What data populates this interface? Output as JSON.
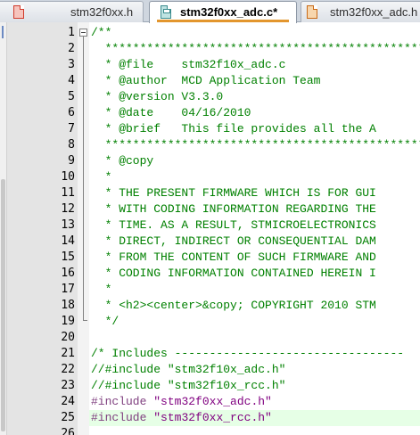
{
  "tabs": [
    {
      "label": "stm32f0xx.h",
      "icon": "file-icon",
      "active": false
    },
    {
      "label": "stm32f0xx_adc.c*",
      "icon": "save-file-icon",
      "active": true
    },
    {
      "label": "stm32f0xx_adc.h",
      "icon": "file-icon",
      "active": false
    }
  ],
  "colors": {
    "comment": "#008000",
    "preprocessor": "#804080",
    "string": "#800080",
    "current_line_bg": "#e6ffe6",
    "gutter_bg": "#e4e4e4"
  },
  "editor": {
    "current_line": 25,
    "lines": [
      {
        "n": "1",
        "kind": "comment",
        "text": "/**"
      },
      {
        "n": "2",
        "kind": "comment",
        "text": "  ******************************************************************"
      },
      {
        "n": "3",
        "kind": "comment",
        "text": "  * @file    stm32f10x_adc.c"
      },
      {
        "n": "4",
        "kind": "comment",
        "text": "  * @author  MCD Application Team"
      },
      {
        "n": "5",
        "kind": "comment",
        "text": "  * @version V3.3.0"
      },
      {
        "n": "6",
        "kind": "comment",
        "text": "  * @date    04/16/2010"
      },
      {
        "n": "7",
        "kind": "comment",
        "text": "  * @brief   This file provides all the A"
      },
      {
        "n": "8",
        "kind": "comment",
        "text": "  ******************************************************************"
      },
      {
        "n": "9",
        "kind": "comment",
        "text": "  * @copy"
      },
      {
        "n": "10",
        "kind": "comment",
        "text": "  *"
      },
      {
        "n": "11",
        "kind": "comment",
        "text": "  * THE PRESENT FIRMWARE WHICH IS FOR GUI"
      },
      {
        "n": "12",
        "kind": "comment",
        "text": "  * WITH CODING INFORMATION REGARDING THE"
      },
      {
        "n": "13",
        "kind": "comment",
        "text": "  * TIME. AS A RESULT, STMICROELECTRONICS"
      },
      {
        "n": "14",
        "kind": "comment",
        "text": "  * DIRECT, INDIRECT OR CONSEQUENTIAL DAM"
      },
      {
        "n": "15",
        "kind": "comment",
        "text": "  * FROM THE CONTENT OF SUCH FIRMWARE AND"
      },
      {
        "n": "16",
        "kind": "comment",
        "text": "  * CODING INFORMATION CONTAINED HEREIN I"
      },
      {
        "n": "17",
        "kind": "comment",
        "text": "  *"
      },
      {
        "n": "18",
        "kind": "comment",
        "text": "  * <h2><center>&copy; COPYRIGHT 2010 STM"
      },
      {
        "n": "19",
        "kind": "comment",
        "text": "  */"
      },
      {
        "n": "20",
        "kind": "plain",
        "text": ""
      },
      {
        "n": "21",
        "kind": "comment",
        "text": "/* Includes ---------------------------------"
      },
      {
        "n": "22",
        "kind": "comment",
        "text": "//#include \"stm32f10x_adc.h\""
      },
      {
        "n": "23",
        "kind": "comment",
        "text": "//#include \"stm32f10x_rcc.h\""
      },
      {
        "n": "24",
        "kind": "include",
        "directive": "#include",
        "file": "\"stm32f0xx_adc.h\""
      },
      {
        "n": "25",
        "kind": "include",
        "directive": "#include",
        "file": "\"stm32f0xx_rcc.h\""
      },
      {
        "n": "26",
        "kind": "plain",
        "text": ""
      }
    ]
  }
}
